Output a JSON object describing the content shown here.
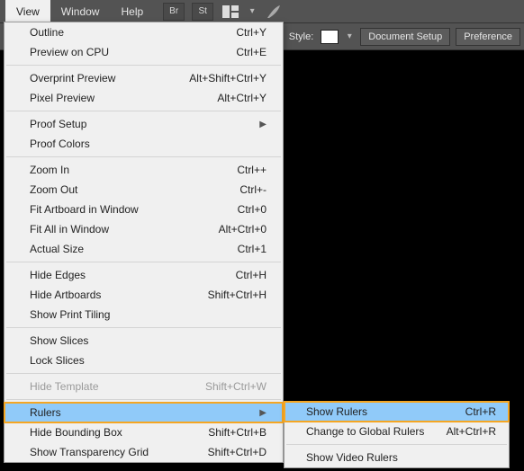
{
  "menubar": {
    "view": "View",
    "window": "Window",
    "help": "Help",
    "br": "Br",
    "st": "St"
  },
  "toolbar": {
    "style_label": "Style:",
    "doc_setup": "Document Setup",
    "preferences": "Preference"
  },
  "menu": {
    "outline": {
      "label": "Outline",
      "sc": "Ctrl+Y"
    },
    "preview_cpu": {
      "label": "Preview on CPU",
      "sc": "Ctrl+E"
    },
    "overprint": {
      "label": "Overprint Preview",
      "sc": "Alt+Shift+Ctrl+Y"
    },
    "pixel": {
      "label": "Pixel Preview",
      "sc": "Alt+Ctrl+Y"
    },
    "proof_setup": {
      "label": "Proof Setup"
    },
    "proof_colors": {
      "label": "Proof Colors"
    },
    "zoom_in": {
      "label": "Zoom In",
      "sc": "Ctrl++"
    },
    "zoom_out": {
      "label": "Zoom Out",
      "sc": "Ctrl+-"
    },
    "fit_artboard": {
      "label": "Fit Artboard in Window",
      "sc": "Ctrl+0"
    },
    "fit_all": {
      "label": "Fit All in Window",
      "sc": "Alt+Ctrl+0"
    },
    "actual_size": {
      "label": "Actual Size",
      "sc": "Ctrl+1"
    },
    "hide_edges": {
      "label": "Hide Edges",
      "sc": "Ctrl+H"
    },
    "hide_artboards": {
      "label": "Hide Artboards",
      "sc": "Shift+Ctrl+H"
    },
    "show_print_tiling": {
      "label": "Show Print Tiling"
    },
    "show_slices": {
      "label": "Show Slices"
    },
    "lock_slices": {
      "label": "Lock Slices"
    },
    "hide_template": {
      "label": "Hide Template",
      "sc": "Shift+Ctrl+W"
    },
    "rulers": {
      "label": "Rulers"
    },
    "hide_bbox": {
      "label": "Hide Bounding Box",
      "sc": "Shift+Ctrl+B"
    },
    "show_transp": {
      "label": "Show Transparency Grid",
      "sc": "Shift+Ctrl+D"
    }
  },
  "submenu": {
    "show_rulers": {
      "label": "Show Rulers",
      "sc": "Ctrl+R"
    },
    "change_global": {
      "label": "Change to Global Rulers",
      "sc": "Alt+Ctrl+R"
    },
    "show_video": {
      "label": "Show Video Rulers"
    }
  }
}
